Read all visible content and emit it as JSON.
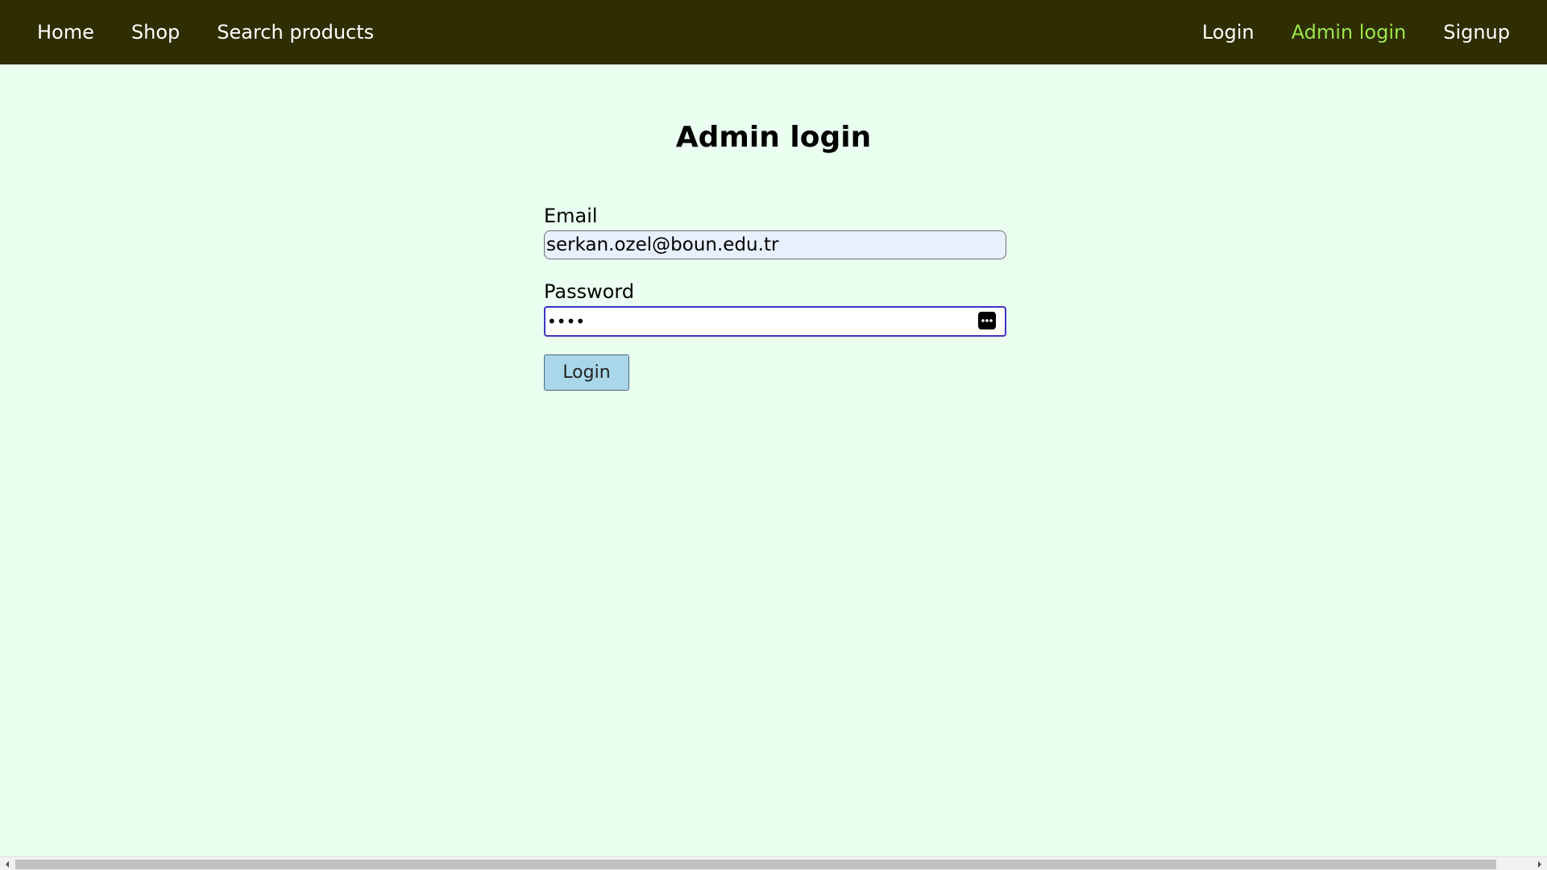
{
  "nav": {
    "left": [
      {
        "label": "Home"
      },
      {
        "label": "Shop"
      },
      {
        "label": "Search products"
      }
    ],
    "right": [
      {
        "label": "Login"
      },
      {
        "label": "Admin login"
      },
      {
        "label": "Signup"
      }
    ],
    "active": "Admin login",
    "background_color": "#2e2e00",
    "active_color": "#9ee64a"
  },
  "page": {
    "title": "Admin login",
    "background_color": "#eafff0"
  },
  "form": {
    "email_label": "Email",
    "email_value": "serkan.ozel@boun.edu.tr",
    "password_label": "Password",
    "password_value": "••••",
    "password_manager_icon": "password-manager-icon",
    "submit_label": "Login",
    "submit_color": "#a9d6e8"
  }
}
